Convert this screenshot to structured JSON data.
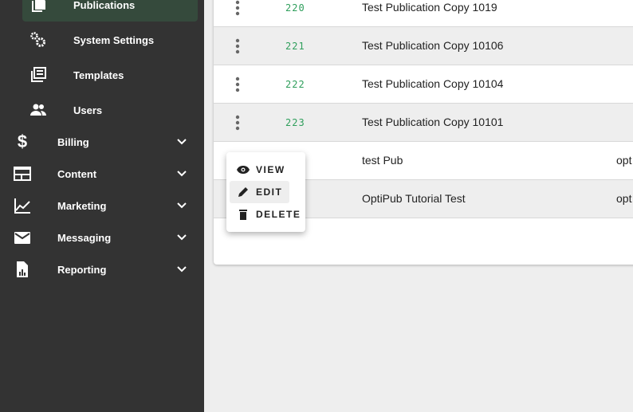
{
  "sidebar": {
    "sub_items": [
      {
        "label": "Publications",
        "icon": "file-copy-icon",
        "active": true
      },
      {
        "label": "System Settings",
        "icon": "gears-icon"
      },
      {
        "label": "Templates",
        "icon": "newspaper-icon"
      },
      {
        "label": "Users",
        "icon": "users-icon"
      }
    ],
    "groups": [
      {
        "label": "Billing",
        "icon": "dollar-icon"
      },
      {
        "label": "Content",
        "icon": "content-icon"
      },
      {
        "label": "Marketing",
        "icon": "chart-line-icon"
      },
      {
        "label": "Messaging",
        "icon": "envelope-icon"
      },
      {
        "label": "Reporting",
        "icon": "report-icon"
      }
    ]
  },
  "table": {
    "rows": [
      {
        "id": "220",
        "name": "Test Publication Copy 1019",
        "extra": ""
      },
      {
        "id": "221",
        "name": "Test Publication Copy 10106",
        "extra": ""
      },
      {
        "id": "222",
        "name": "Test Publication Copy 10104",
        "extra": ""
      },
      {
        "id": "223",
        "name": "Test Publication Copy 10101",
        "extra": ""
      },
      {
        "id": "",
        "name": "test Pub",
        "extra": "opt"
      },
      {
        "id": "",
        "name": "OptiPub Tutorial Test",
        "extra": "opt"
      }
    ]
  },
  "menu": {
    "items": [
      {
        "label": "VIEW",
        "icon": "eye-icon"
      },
      {
        "label": "EDIT",
        "icon": "pencil-icon",
        "highlighted": true
      },
      {
        "label": "DELETE",
        "icon": "trash-icon"
      }
    ]
  },
  "colors": {
    "sidebar": "#333333",
    "active": "#354a3c",
    "id_text": "#2e9e5b"
  }
}
